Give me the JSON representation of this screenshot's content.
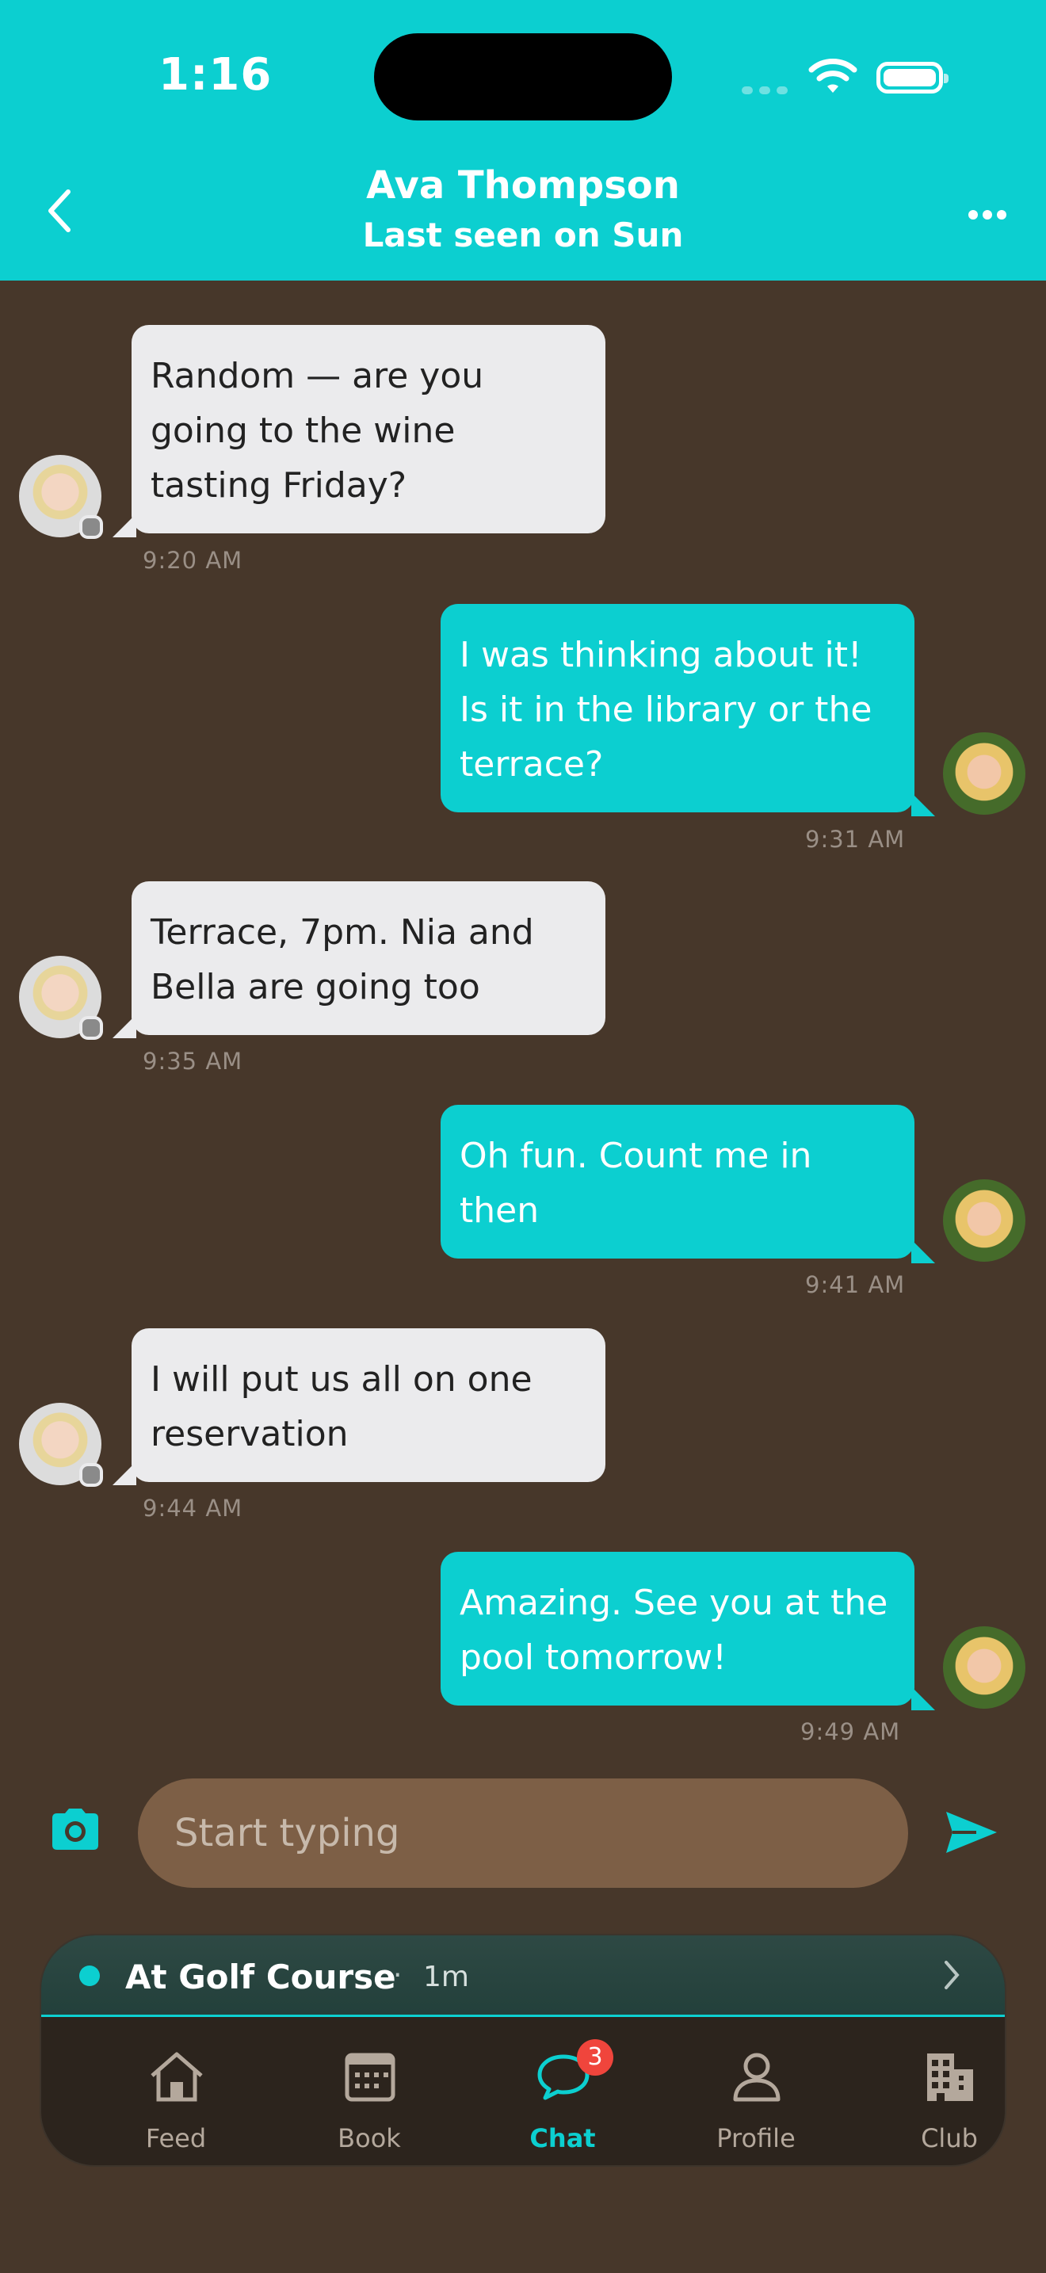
{
  "status_bar": {
    "time": "1:16"
  },
  "header": {
    "name": "Ava Thompson",
    "subtitle": "Last seen on Sun"
  },
  "messages": [
    {
      "from": "them",
      "text": "Random — are you going to the wine tasting Friday?",
      "time": "9:20 AM"
    },
    {
      "from": "me",
      "text": "I was thinking about it! Is it in the library or the terrace?",
      "time": "9:31 AM"
    },
    {
      "from": "them",
      "text": "Terrace, 7pm. Nia and Bella are going too",
      "time": "9:35 AM"
    },
    {
      "from": "me",
      "text": "Oh fun. Count me in then",
      "time": "9:41 AM"
    },
    {
      "from": "them",
      "text": "I will put us all on one reservation",
      "time": "9:44 AM"
    },
    {
      "from": "me",
      "text": "Amazing. See you at the pool tomorrow!",
      "time": "9:49 AM"
    }
  ],
  "composer": {
    "placeholder": "Start typing"
  },
  "activity": {
    "label": "At Golf Course",
    "separator": "·",
    "duration": "1m"
  },
  "tabs": [
    {
      "label": "Feed",
      "icon": "home-icon"
    },
    {
      "label": "Book",
      "icon": "calendar-icon"
    },
    {
      "label": "Chat",
      "icon": "chat-bubble-icon",
      "badge": "3",
      "active": true
    },
    {
      "label": "Profile",
      "icon": "person-icon"
    },
    {
      "label": "Club",
      "icon": "building-icon"
    }
  ],
  "colors": {
    "accent": "#0ccfd0",
    "background": "#47372a",
    "incoming_bubble": "#ebebed",
    "badge": "#f0453c"
  }
}
